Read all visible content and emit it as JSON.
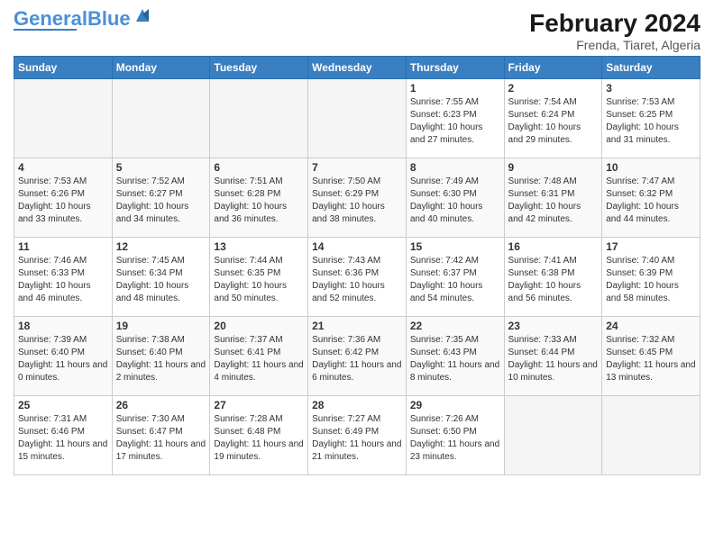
{
  "header": {
    "logo_general": "General",
    "logo_blue": "Blue",
    "title": "February 2024",
    "subtitle": "Frenda, Tiaret, Algeria"
  },
  "weekdays": [
    "Sunday",
    "Monday",
    "Tuesday",
    "Wednesday",
    "Thursday",
    "Friday",
    "Saturday"
  ],
  "weeks": [
    [
      {
        "day": "",
        "info": ""
      },
      {
        "day": "",
        "info": ""
      },
      {
        "day": "",
        "info": ""
      },
      {
        "day": "",
        "info": ""
      },
      {
        "day": "1",
        "info": "Sunrise: 7:55 AM\nSunset: 6:23 PM\nDaylight: 10 hours and 27 minutes."
      },
      {
        "day": "2",
        "info": "Sunrise: 7:54 AM\nSunset: 6:24 PM\nDaylight: 10 hours and 29 minutes."
      },
      {
        "day": "3",
        "info": "Sunrise: 7:53 AM\nSunset: 6:25 PM\nDaylight: 10 hours and 31 minutes."
      }
    ],
    [
      {
        "day": "4",
        "info": "Sunrise: 7:53 AM\nSunset: 6:26 PM\nDaylight: 10 hours and 33 minutes."
      },
      {
        "day": "5",
        "info": "Sunrise: 7:52 AM\nSunset: 6:27 PM\nDaylight: 10 hours and 34 minutes."
      },
      {
        "day": "6",
        "info": "Sunrise: 7:51 AM\nSunset: 6:28 PM\nDaylight: 10 hours and 36 minutes."
      },
      {
        "day": "7",
        "info": "Sunrise: 7:50 AM\nSunset: 6:29 PM\nDaylight: 10 hours and 38 minutes."
      },
      {
        "day": "8",
        "info": "Sunrise: 7:49 AM\nSunset: 6:30 PM\nDaylight: 10 hours and 40 minutes."
      },
      {
        "day": "9",
        "info": "Sunrise: 7:48 AM\nSunset: 6:31 PM\nDaylight: 10 hours and 42 minutes."
      },
      {
        "day": "10",
        "info": "Sunrise: 7:47 AM\nSunset: 6:32 PM\nDaylight: 10 hours and 44 minutes."
      }
    ],
    [
      {
        "day": "11",
        "info": "Sunrise: 7:46 AM\nSunset: 6:33 PM\nDaylight: 10 hours and 46 minutes."
      },
      {
        "day": "12",
        "info": "Sunrise: 7:45 AM\nSunset: 6:34 PM\nDaylight: 10 hours and 48 minutes."
      },
      {
        "day": "13",
        "info": "Sunrise: 7:44 AM\nSunset: 6:35 PM\nDaylight: 10 hours and 50 minutes."
      },
      {
        "day": "14",
        "info": "Sunrise: 7:43 AM\nSunset: 6:36 PM\nDaylight: 10 hours and 52 minutes."
      },
      {
        "day": "15",
        "info": "Sunrise: 7:42 AM\nSunset: 6:37 PM\nDaylight: 10 hours and 54 minutes."
      },
      {
        "day": "16",
        "info": "Sunrise: 7:41 AM\nSunset: 6:38 PM\nDaylight: 10 hours and 56 minutes."
      },
      {
        "day": "17",
        "info": "Sunrise: 7:40 AM\nSunset: 6:39 PM\nDaylight: 10 hours and 58 minutes."
      }
    ],
    [
      {
        "day": "18",
        "info": "Sunrise: 7:39 AM\nSunset: 6:40 PM\nDaylight: 11 hours and 0 minutes."
      },
      {
        "day": "19",
        "info": "Sunrise: 7:38 AM\nSunset: 6:40 PM\nDaylight: 11 hours and 2 minutes."
      },
      {
        "day": "20",
        "info": "Sunrise: 7:37 AM\nSunset: 6:41 PM\nDaylight: 11 hours and 4 minutes."
      },
      {
        "day": "21",
        "info": "Sunrise: 7:36 AM\nSunset: 6:42 PM\nDaylight: 11 hours and 6 minutes."
      },
      {
        "day": "22",
        "info": "Sunrise: 7:35 AM\nSunset: 6:43 PM\nDaylight: 11 hours and 8 minutes."
      },
      {
        "day": "23",
        "info": "Sunrise: 7:33 AM\nSunset: 6:44 PM\nDaylight: 11 hours and 10 minutes."
      },
      {
        "day": "24",
        "info": "Sunrise: 7:32 AM\nSunset: 6:45 PM\nDaylight: 11 hours and 13 minutes."
      }
    ],
    [
      {
        "day": "25",
        "info": "Sunrise: 7:31 AM\nSunset: 6:46 PM\nDaylight: 11 hours and 15 minutes."
      },
      {
        "day": "26",
        "info": "Sunrise: 7:30 AM\nSunset: 6:47 PM\nDaylight: 11 hours and 17 minutes."
      },
      {
        "day": "27",
        "info": "Sunrise: 7:28 AM\nSunset: 6:48 PM\nDaylight: 11 hours and 19 minutes."
      },
      {
        "day": "28",
        "info": "Sunrise: 7:27 AM\nSunset: 6:49 PM\nDaylight: 11 hours and 21 minutes."
      },
      {
        "day": "29",
        "info": "Sunrise: 7:26 AM\nSunset: 6:50 PM\nDaylight: 11 hours and 23 minutes."
      },
      {
        "day": "",
        "info": ""
      },
      {
        "day": "",
        "info": ""
      }
    ]
  ]
}
